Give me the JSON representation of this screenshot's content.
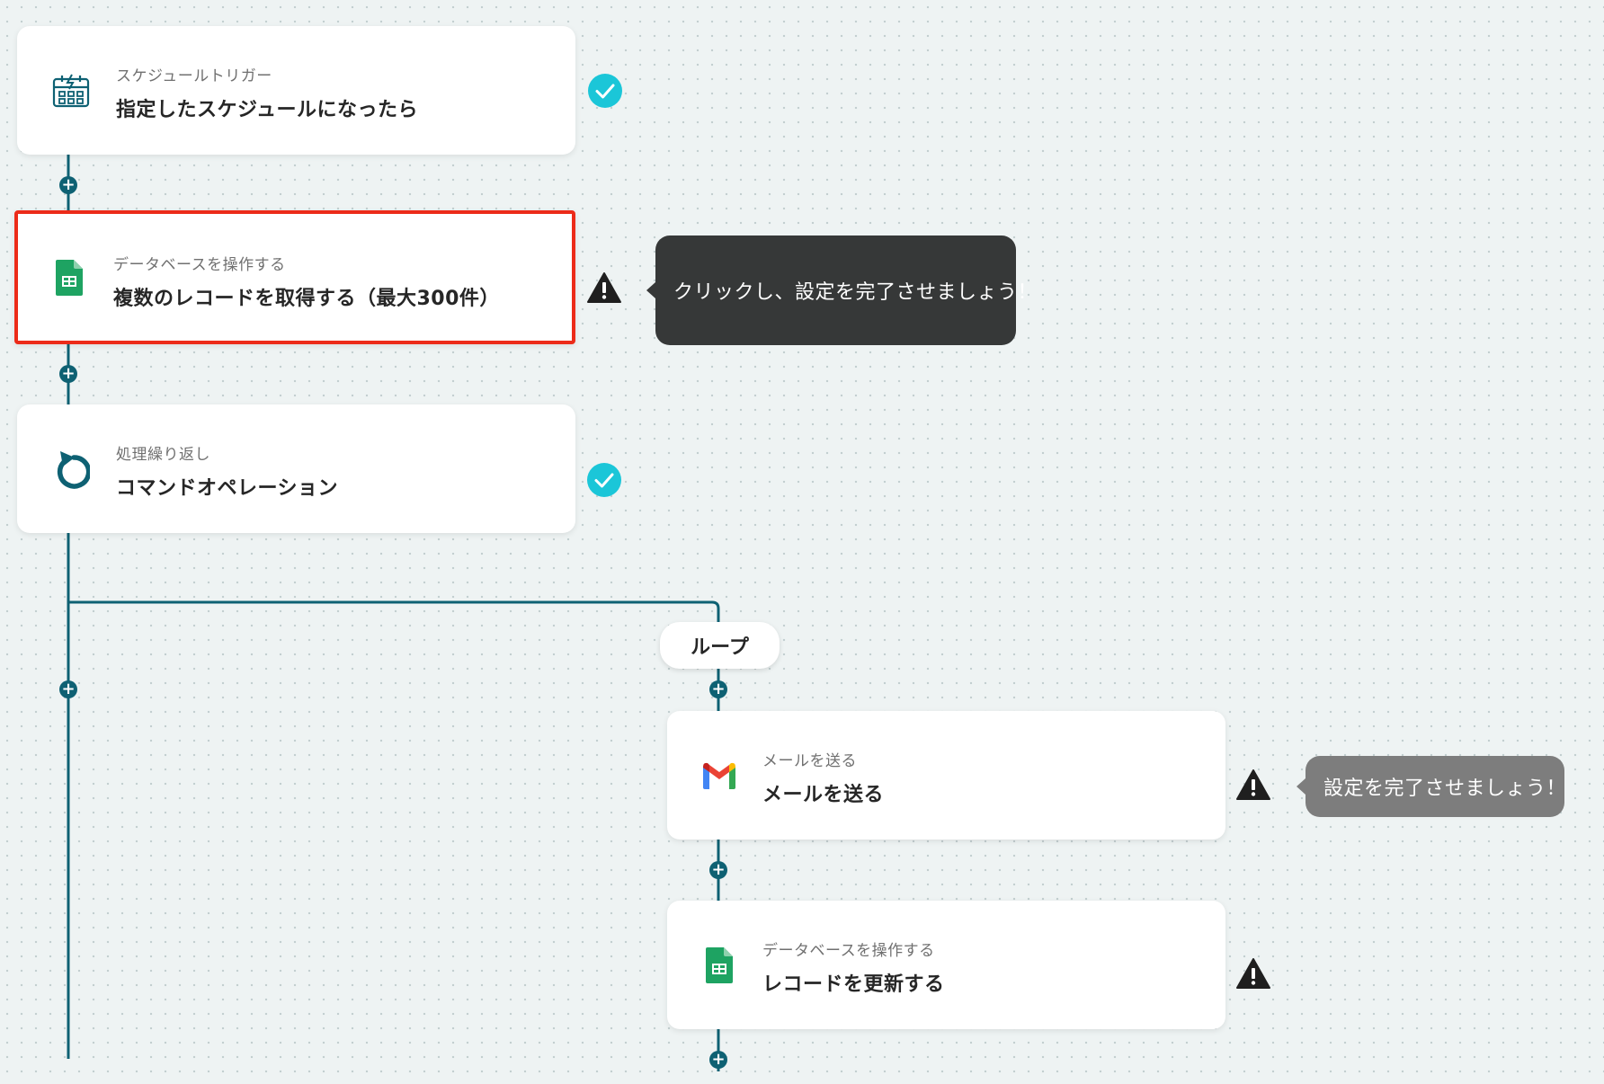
{
  "theme": {
    "line_color": "#0e6173",
    "check_color": "#1bc6d8",
    "warning_color": "#1f1f1f",
    "highlight_border": "#ec2b19",
    "sheets_green": "#1ea362"
  },
  "nodes": [
    {
      "id": "schedule-trigger",
      "subtitle": "スケジュールトリガー",
      "title": "指定したスケジュールになったら",
      "icon": "calendar-lightning-icon",
      "status": "complete"
    },
    {
      "id": "get-records",
      "subtitle": "データベースを操作する",
      "title": "複数のレコードを取得する（最大300件）",
      "icon": "google-sheets-icon",
      "status": "warning",
      "highlighted": true
    },
    {
      "id": "command-operation",
      "subtitle": "処理繰り返し",
      "title": "コマンドオペレーション",
      "icon": "loop-arrow-icon",
      "status": "complete"
    },
    {
      "id": "send-mail",
      "subtitle": "メールを送る",
      "title": "メールを送る",
      "icon": "gmail-icon",
      "status": "warning"
    },
    {
      "id": "update-record",
      "subtitle": "データベースを操作する",
      "title": "レコードを更新する",
      "icon": "google-sheets-icon",
      "status": "warning"
    }
  ],
  "loop_label": "ループ",
  "tooltips": {
    "get_records": "クリックし、設定を完了させましょう！",
    "send_mail": "設定を完了させましょう！"
  },
  "plus_label": "+"
}
